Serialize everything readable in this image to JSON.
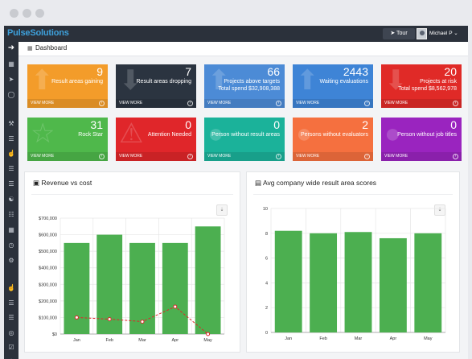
{
  "app": {
    "logo": "PulseSolutions",
    "tour_label": "Tour",
    "user_name": "Michael P"
  },
  "breadcrumb": {
    "title": "Dashboard"
  },
  "colors": {
    "orange": "#f39c2a",
    "navy": "#2b3440",
    "blue": "#4c8bd6",
    "blue2": "#3e84d6",
    "red": "#e02a27",
    "green": "#4fb84b",
    "crimson": "#e0262a",
    "teal": "#1bb29a",
    "coral": "#f5703f",
    "purple": "#9a24bf",
    "bar_green": "#4caf50",
    "line_red": "#e0262a"
  },
  "tiles": [
    {
      "number": "9",
      "label": "Result areas gaining",
      "sub": "",
      "view_more": "VIEW MORE",
      "color": "#f39c2a",
      "icon": "arrow-up-icon"
    },
    {
      "number": "7",
      "label": "Result areas dropping",
      "sub": "",
      "view_more": "VIEW MORE",
      "color": "#2b3440",
      "icon": "arrow-down-icon"
    },
    {
      "number": "66",
      "label": "Projects above targets",
      "sub": "Total spend $32,908,388",
      "view_more": "VIEW MORE",
      "color": "#4c8bd6",
      "icon": "arrow-up-icon"
    },
    {
      "number": "2443",
      "label": "Waiting evaluations",
      "sub": "",
      "view_more": "VIEW MORE",
      "color": "#3e84d6",
      "icon": "arrow-up-icon"
    },
    {
      "number": "20",
      "label": "Projects at risk",
      "sub": "Total spend $8,562,978",
      "view_more": "VIEW MORE",
      "color": "#e02a27",
      "icon": "arrow-down-icon"
    },
    {
      "number": "31",
      "label": "Rock Star",
      "sub": "",
      "view_more": "VIEW MORE",
      "color": "#4fb84b",
      "icon": "star-icon"
    },
    {
      "number": "0",
      "label": "Attention Needed",
      "sub": "",
      "view_more": "VIEW MORE",
      "color": "#e0262a",
      "icon": "warning-icon"
    },
    {
      "number": "0",
      "label": "Person without result areas",
      "sub": "",
      "view_more": "VIEW MORE",
      "color": "#1bb29a",
      "icon": "user-icon"
    },
    {
      "number": "2",
      "label": "Persons without evaluators",
      "sub": "",
      "view_more": "VIEW MORE",
      "color": "#f5703f",
      "icon": "user-icon"
    },
    {
      "number": "0",
      "label": "Person without job titles",
      "sub": "",
      "view_more": "VIEW MORE",
      "color": "#9a24bf",
      "icon": "user-icon"
    }
  ],
  "chart_data": [
    {
      "type": "bar",
      "title": "Revenue vs cost",
      "categories": [
        "Jan",
        "Feb",
        "Mar",
        "Apr",
        "May"
      ],
      "series": [
        {
          "type": "bar",
          "values": [
            550000,
            600000,
            550000,
            550000,
            650000
          ]
        },
        {
          "type": "line",
          "values": [
            100000,
            90000,
            75000,
            165000,
            0
          ]
        }
      ],
      "yticks": [
        "$0",
        "$100,000",
        "$200,000",
        "$300,000",
        "$400,000",
        "$500,000",
        "$600,000",
        "$700,000"
      ],
      "ylim": [
        0,
        700000
      ],
      "grid": true
    },
    {
      "type": "bar",
      "title": "Avg company wide result area scores",
      "categories": [
        "Jan",
        "Feb",
        "Mar",
        "Apr",
        "May"
      ],
      "values": [
        8.2,
        8.0,
        8.1,
        7.6,
        8.0
      ],
      "yticks": [
        "0",
        "2",
        "4",
        "6",
        "8",
        "10"
      ],
      "ylim": [
        0,
        10
      ],
      "grid": true
    }
  ]
}
